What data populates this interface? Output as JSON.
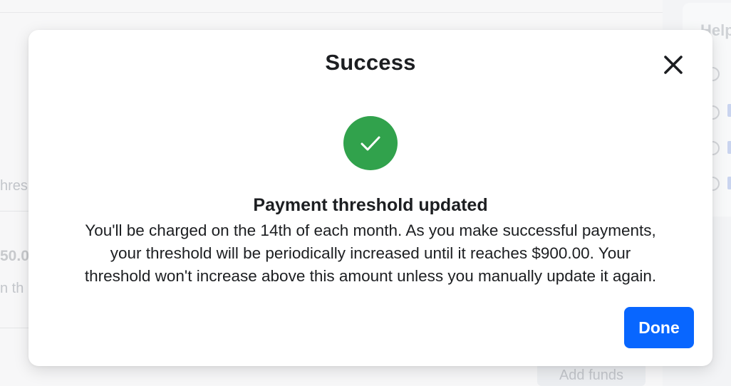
{
  "background": {
    "left_partial_texts": [
      "hres",
      "50.0",
      "n th"
    ],
    "add_funds_label": "Add funds",
    "help_title_partial": "Help"
  },
  "modal": {
    "title": "Success",
    "close_icon": "close-icon",
    "status_icon": "checkmark-icon",
    "headline": "Payment threshold updated",
    "body_lines": [
      "You'll be charged on the 14th of each month. As you make successful payments,",
      "your threshold will be periodically increased until it reaches $900.00. Your",
      "threshold won't increase above this amount unless you manually update it again."
    ],
    "done_label": "Done"
  },
  "colors": {
    "success_green": "#31a24c",
    "primary_blue": "#0866ff",
    "text_dark": "#1c1e21"
  }
}
